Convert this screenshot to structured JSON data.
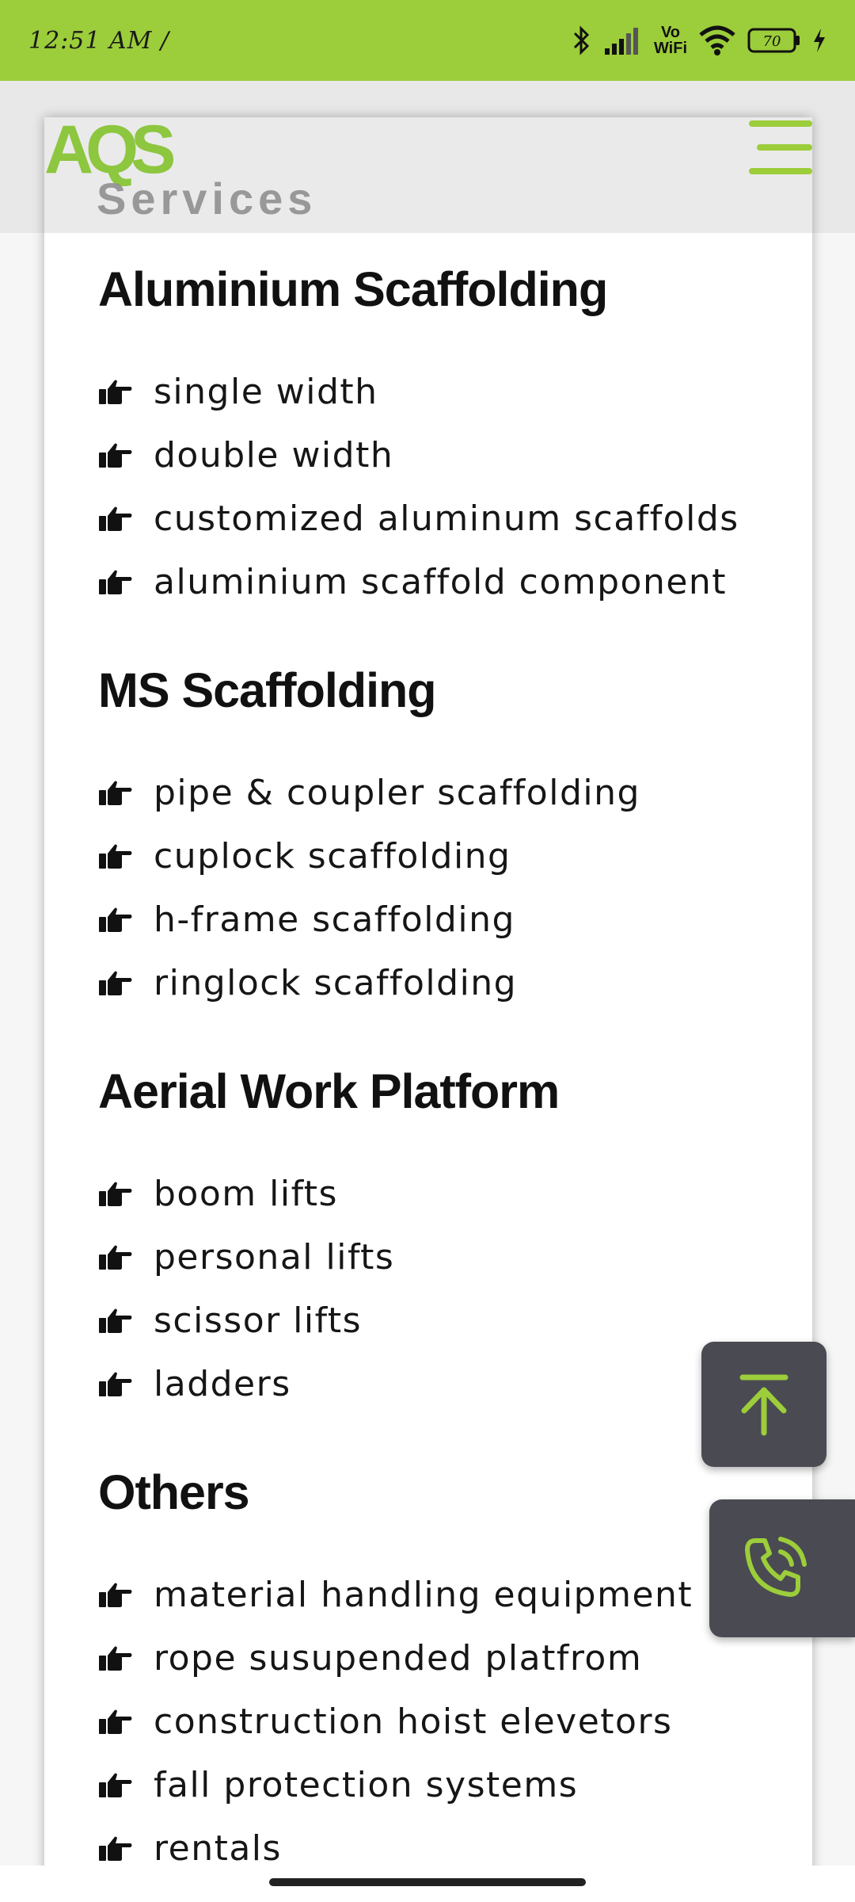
{
  "status_bar": {
    "time": "12:51 AM /",
    "network_label": "Vo\nWiFi",
    "battery": "70",
    "accent": "#9ccd3a"
  },
  "header": {
    "logo": "AQS",
    "page_title": "Services",
    "menu_icon": "hamburger-menu-icon",
    "brand_color": "#8dc63f"
  },
  "sections": [
    {
      "title": "Aluminium Scaffolding",
      "items": [
        "single width",
        "double width",
        "customized aluminum scaffolds",
        "aluminium scaffold component"
      ]
    },
    {
      "title": "MS Scaffolding",
      "items": [
        "pipe & coupler scaffolding",
        "cuplock scaffolding",
        "h-frame scaffolding",
        "ringlock scaffolding"
      ]
    },
    {
      "title": "Aerial Work Platform",
      "items": [
        "boom lifts",
        "personal lifts",
        "scissor lifts",
        "ladders"
      ]
    },
    {
      "title": "Others",
      "items": [
        "material handling equipment",
        "rope susupended platfrom",
        "construction hoist elevetors",
        "fall protection systems",
        "rentals"
      ]
    }
  ],
  "buttons": {
    "scroll_top_icon": "arrow-up-to-top-icon",
    "call_icon": "phone-call-icon",
    "button_bg": "#4a4a52"
  }
}
